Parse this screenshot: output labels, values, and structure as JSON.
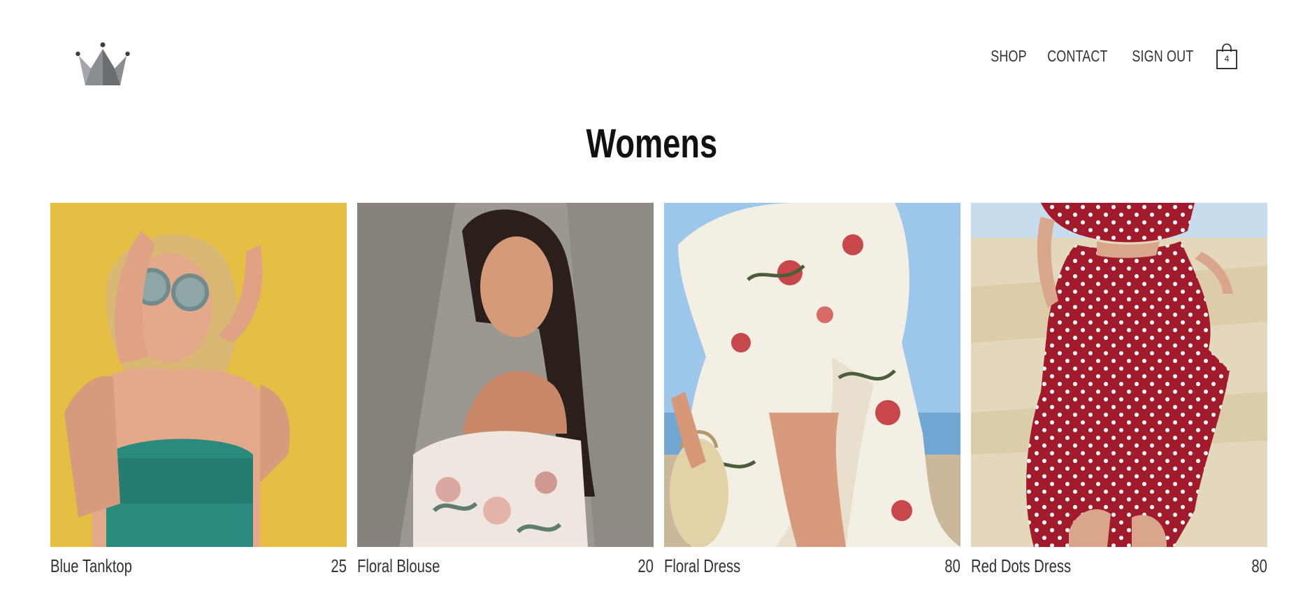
{
  "header": {
    "logo_icon": "crown-logo-icon",
    "nav": [
      {
        "label": "SHOP"
      },
      {
        "label": "CONTACT"
      },
      {
        "label": "SIGN OUT"
      }
    ],
    "cart": {
      "icon": "shopping-bag-icon",
      "count": "4"
    }
  },
  "page": {
    "title": "Womens"
  },
  "products": [
    {
      "name": "Blue Tanktop",
      "price": "25"
    },
    {
      "name": "Floral Blouse",
      "price": "20"
    },
    {
      "name": "Floral Dress",
      "price": "80"
    },
    {
      "name": "Red Dots Dress",
      "price": "80"
    }
  ],
  "colors": {
    "logo": "#7a7e82",
    "text": "#333333",
    "background": "#ffffff"
  }
}
